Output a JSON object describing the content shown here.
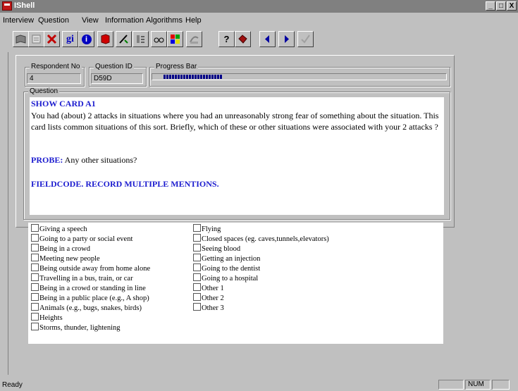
{
  "window": {
    "title": "IShell",
    "min_label": "_",
    "max_label": "□",
    "close_label": "X"
  },
  "menu": [
    "Interview",
    "Question",
    "View",
    "Information",
    "Algorithms",
    "Help"
  ],
  "toolbar": {
    "gi_label": "gi",
    "info_label": "i",
    "help_label": "?",
    "buttons": [
      "open-book-icon",
      "notepad-icon",
      "delete-icon",
      "gi-icon",
      "info-icon",
      "book-red-icon",
      "edit-icon",
      "list-icon",
      "glasses-icon",
      "color-palette-icon",
      "skip-icon",
      "help-icon",
      "codebook-icon",
      "previous-icon",
      "next-icon",
      "check-icon"
    ]
  },
  "respondent": {
    "label": "Respondent No",
    "value": "4"
  },
  "question_id": {
    "label": "Question ID",
    "value": "D59D"
  },
  "progress": {
    "label": "Progress Bar",
    "fraction": 0.21
  },
  "question": {
    "label": "Question",
    "show_card": "SHOW CARD A1",
    "text": "You had (about) 2 attacks in  situations where you had an unreasonably strong fear of something about the situation. This card lists common situations of this sort. Briefly, which of these or other situations were associated with your 2 attacks ?",
    "probe_label": "PROBE:",
    "probe_text": " Any other situations?",
    "fieldcode": "FIELDCODE. RECORD MULTIPLE MENTIONS."
  },
  "answers": {
    "left": [
      "Giving a speech",
      "Going to a party or social event",
      "Being in a crowd",
      "Meeting new people",
      "Being outside away from home alone",
      "Travelling in a bus, train, or car",
      "Being in a crowd or standing in line",
      "Being in a public place (e.g., A shop)",
      "Animals (e.g., bugs, snakes, birds)",
      "Heights",
      "Storms, thunder, lightening"
    ],
    "right": [
      "Flying",
      "Closed spaces (eg. caves,tunnels,elevators)",
      "Seeing blood",
      "Getting an injection",
      "Going to the dentist",
      "Going to a hospital",
      "Other 1",
      "Other 2",
      "Other 3"
    ]
  },
  "status": {
    "text": "Ready",
    "num": "NUM"
  }
}
